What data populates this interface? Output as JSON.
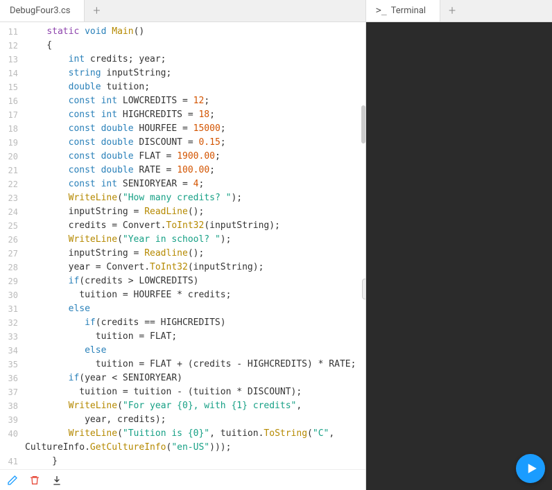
{
  "editor": {
    "tab_label": "DebugFour3.cs",
    "lines": [
      11,
      12,
      13,
      14,
      15,
      16,
      17,
      18,
      19,
      20,
      21,
      22,
      23,
      24,
      25,
      26,
      27,
      28,
      29,
      30,
      31,
      32,
      33,
      34,
      35,
      36,
      37,
      38,
      39,
      40,
      "",
      41
    ],
    "code": {
      "l11": {
        "indent": "    ",
        "kw1": "static",
        "sp": " ",
        "kw2": "void",
        "sp2": " ",
        "fn": "Main",
        "rest": "()"
      },
      "l12": "    {",
      "l13": {
        "indent": "        ",
        "kw": "int",
        "rest": " credits; year;"
      },
      "l14": {
        "indent": "        ",
        "kw": "string",
        "rest": " inputString;"
      },
      "l15": {
        "indent": "        ",
        "kw": "double",
        "rest": " tuition;"
      },
      "l16": {
        "indent": "        ",
        "kw1": "const",
        "sp": " ",
        "kw2": "int",
        "rest": " LOWCREDITS = ",
        "num": "12",
        "semi": ";"
      },
      "l17": {
        "indent": "        ",
        "kw1": "const",
        "sp": " ",
        "kw2": "int",
        "rest": " HIGHCREDITS = ",
        "num": "18",
        "semi": ";"
      },
      "l18": {
        "indent": "        ",
        "kw1": "const",
        "sp": " ",
        "kw2": "double",
        "rest": " HOURFEE = ",
        "num": "15000",
        "semi": ";"
      },
      "l19": {
        "indent": "        ",
        "kw1": "const",
        "sp": " ",
        "kw2": "double",
        "rest": " DISCOUNT = ",
        "num": "0.15",
        "semi": ";"
      },
      "l20": {
        "indent": "        ",
        "kw1": "const",
        "sp": " ",
        "kw2": "double",
        "rest": " FLAT = ",
        "num": "1900.00",
        "semi": ";"
      },
      "l21": {
        "indent": "        ",
        "kw1": "const",
        "sp": " ",
        "kw2": "double",
        "rest": " RATE = ",
        "num": "100.00",
        "semi": ";"
      },
      "l22": {
        "indent": "        ",
        "kw1": "const",
        "sp": " ",
        "kw2": "int",
        "rest": " SENIORYEAR = ",
        "num": "4",
        "semi": ";"
      },
      "l23": {
        "indent": "        ",
        "fn": "WriteLine",
        "open": "(",
        "str": "\"How many credits? \"",
        "close": ");"
      },
      "l24": {
        "indent": "        ",
        "pre": "inputString = ",
        "fn": "ReadLine",
        "rest": "();"
      },
      "l25": {
        "indent": "        ",
        "pre": "credits = Convert.",
        "fn": "ToInt32",
        "rest": "(inputString);"
      },
      "l26": {
        "indent": "        ",
        "fn": "WriteLine",
        "open": "(",
        "str": "\"Year in school? \"",
        "close": ");"
      },
      "l27": {
        "indent": "        ",
        "pre": "inputString = ",
        "fn": "Readline",
        "rest": "();"
      },
      "l28": {
        "indent": "        ",
        "pre": "year = Convert.",
        "fn": "ToInt32",
        "rest": "(inputString);"
      },
      "l29": {
        "indent": "        ",
        "kw": "if",
        "rest": "(credits > LOWCREDITS)"
      },
      "l30": "          tuition = HOURFEE * credits;",
      "l31": {
        "indent": "        ",
        "kw": "else"
      },
      "l32": {
        "indent": "           ",
        "kw": "if",
        "rest": "(credits == HIGHCREDITS)"
      },
      "l33": "             tuition = FLAT;",
      "l34": {
        "indent": "           ",
        "kw": "else"
      },
      "l35": "             tuition = FLAT + (credits - HIGHCREDITS) * RATE;",
      "l36": {
        "indent": "        ",
        "kw": "if",
        "rest": "(year < SENIORYEAR)"
      },
      "l37": "          tuition = tuition - (tuition * DISCOUNT);",
      "l38": {
        "indent": "        ",
        "fn": "WriteLine",
        "open": "(",
        "str": "\"For year {0}, with {1} credits\"",
        "close": ","
      },
      "l39": "           year, credits);",
      "l40": {
        "indent": "        ",
        "fn": "WriteLine",
        "open": "(",
        "str": "\"Tuition is {0}\"",
        "mid": ", tuition.",
        "fn2": "ToString",
        "open2": "(",
        "str2": "\"C\"",
        "close2": ","
      },
      "l40b": {
        "pre": "CultureInfo.",
        "fn": "GetCultureInfo",
        "open": "(",
        "str": "\"en-US\"",
        "close": ")));"
      },
      "l41": "     }"
    }
  },
  "terminal": {
    "tab_label": "Terminal"
  },
  "toolbar": {
    "edit_icon": "pencil-icon",
    "delete_icon": "trash-icon",
    "download_icon": "download-icon"
  }
}
